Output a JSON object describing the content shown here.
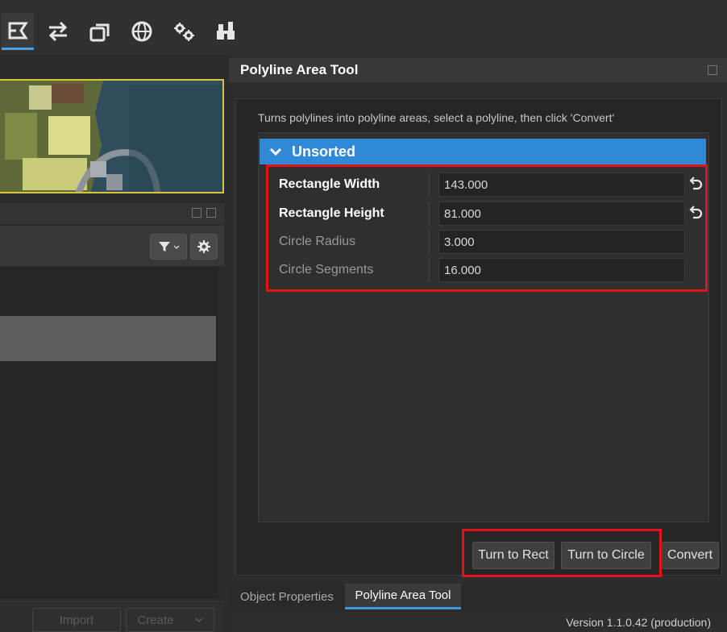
{
  "toolbar": {
    "icons": [
      "polyline-area-icon",
      "swap-arrows-icon",
      "copy-layers-icon",
      "globe-icon",
      "settings-gears-icon",
      "puzzle-blocks-icon"
    ],
    "accent": "#4aa3e0"
  },
  "left_panel": {
    "buttons": {
      "import": "Import",
      "create": "Create"
    }
  },
  "panel": {
    "title": "Polyline Area Tool",
    "description": "Turns polylines into polyline areas, select a polyline, then click 'Convert'",
    "group": {
      "label": "Unsorted",
      "color": "#2f89d6"
    },
    "properties": [
      {
        "label": "Rectangle Width",
        "value": "143.000",
        "modified": true
      },
      {
        "label": "Rectangle Height",
        "value": "81.000",
        "modified": true
      },
      {
        "label": "Circle Radius",
        "value": "3.000",
        "modified": false
      },
      {
        "label": "Circle Segments",
        "value": "16.000",
        "modified": false
      }
    ],
    "buttons": {
      "turn_to_rect": "Turn to Rect",
      "turn_to_circle": "Turn to Circle",
      "convert": "Convert"
    }
  },
  "bottom_tabs": [
    "Object Properties",
    "Polyline Area Tool"
  ],
  "active_tab": "Polyline Area Tool",
  "status": {
    "version": "Version 1.1.0.42 (production)"
  },
  "highlight_color": "#e0141b"
}
